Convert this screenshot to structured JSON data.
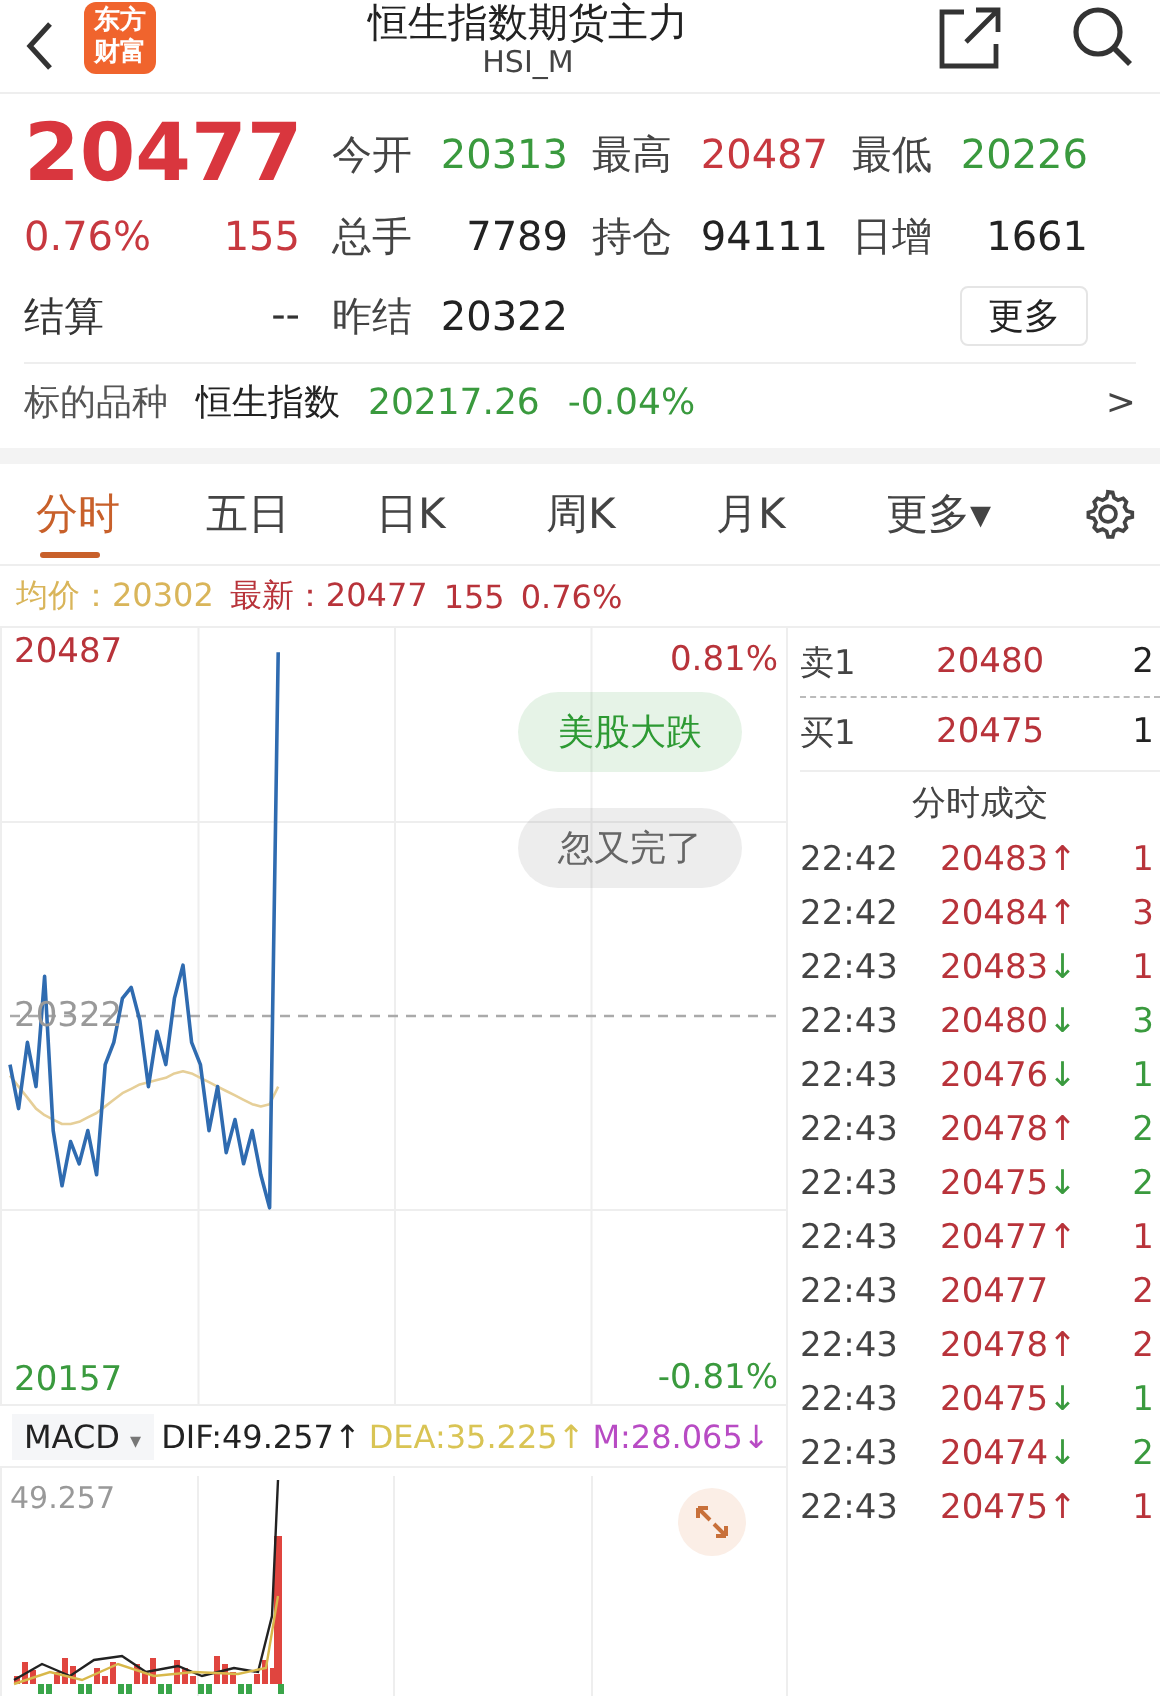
{
  "header": {
    "logo": "东方财富",
    "title": "恒生指数期货主力",
    "code": "HSI_M"
  },
  "quote": {
    "price": "20477",
    "change_pct": "0.76%",
    "change": "155",
    "settle_label": "结算",
    "settle": "--",
    "more": "更多",
    "stats": [
      {
        "label": "今开",
        "value": "20313",
        "color": "#3a9a3e"
      },
      {
        "label": "最高",
        "value": "20487",
        "color": "#c7383f"
      },
      {
        "label": "最低",
        "value": "20226",
        "color": "#3a9a3e"
      },
      {
        "label": "总手",
        "value": "7789",
        "color": "#222222"
      },
      {
        "label": "持仓",
        "value": "94111",
        "color": "#222222"
      },
      {
        "label": "日增",
        "value": "1661",
        "color": "#222222"
      },
      {
        "label": "昨结",
        "value": "20322",
        "color": "#222222"
      }
    ]
  },
  "underlying": {
    "label": "标的品种",
    "name": "恒生指数",
    "price": "20217.26",
    "change": "-0.04%",
    "chevron": ">"
  },
  "tabs": [
    {
      "label": "分时",
      "selected": true
    },
    {
      "label": "五日",
      "selected": false
    },
    {
      "label": "日K",
      "selected": false
    },
    {
      "label": "周K",
      "selected": false
    },
    {
      "label": "月K",
      "selected": false
    },
    {
      "label": "更多▾",
      "selected": false
    }
  ],
  "info": {
    "avg_label": "均价：",
    "avg": "20302",
    "latest_label": "最新：",
    "latest": "20477",
    "change": "155",
    "pct": "0.76%"
  },
  "chart": {
    "high_pct": "0.81%",
    "low_pct": "-0.81%",
    "tags": [
      {
        "text": "美股大跌",
        "color": "#2d9a33"
      },
      {
        "text": "忽又完了",
        "color": "#666666"
      }
    ],
    "chart_data": {
      "type": "line",
      "ylim": [
        20146,
        20498
      ],
      "yticks": [
        20157,
        20322,
        20487
      ],
      "categories": [
        null,
        null,
        null,
        null,
        null,
        null,
        null,
        null,
        null,
        null,
        null,
        null,
        null,
        null,
        null,
        null,
        null,
        null,
        null,
        null,
        null,
        null,
        null,
        null,
        null,
        null,
        null,
        null,
        null,
        null,
        null,
        null,
        null,
        null,
        null,
        null,
        null,
        null,
        null,
        null,
        null,
        null,
        null,
        null,
        null,
        null,
        null,
        null,
        null,
        null,
        null,
        null,
        null,
        null,
        null,
        null,
        null,
        null,
        null,
        null,
        null,
        null,
        null,
        null,
        null,
        null,
        null,
        null,
        null,
        null,
        null,
        null,
        null,
        null,
        null,
        null,
        null,
        null,
        null,
        null,
        null,
        null,
        null,
        null,
        null,
        null,
        null,
        null,
        null,
        null
      ],
      "series": [
        {
          "color": "#2f6bb0",
          "values": [
            20300,
            20280,
            20310,
            20290,
            20340,
            20270,
            20245,
            20265,
            20255,
            20270,
            20250,
            20300,
            20310,
            20330,
            20335,
            20320,
            20290,
            20315,
            20300,
            20330,
            20345,
            20310,
            20300,
            20270,
            20290,
            20260,
            20275,
            20255,
            20270,
            20250,
            20235,
            20487,
            null,
            null,
            null,
            null,
            null,
            null,
            null,
            null,
            null,
            null,
            null,
            null,
            null,
            null,
            null,
            null,
            null,
            null,
            null,
            null,
            null,
            null,
            null,
            null,
            null,
            null,
            null,
            null,
            null,
            null,
            null,
            null,
            null,
            null,
            null,
            null,
            null,
            null,
            null,
            null,
            null,
            null,
            null,
            null,
            null,
            null,
            null,
            null,
            null,
            null,
            null,
            null,
            null,
            null,
            null,
            null,
            null,
            null
          ]
        },
        {
          "color": "#e6cf98",
          "values": [
            20295,
            20290,
            20285,
            20280,
            20277,
            20275,
            20273,
            20273,
            20274,
            20276,
            20278,
            20281,
            20284,
            20287,
            20289,
            20291,
            20292,
            20293,
            20294,
            20296,
            20297,
            20296,
            20294,
            20292,
            20290,
            20288,
            20286,
            20284,
            20282,
            20281,
            20282,
            20290,
            null,
            null,
            null,
            null,
            null,
            null,
            null,
            null,
            null,
            null,
            null,
            null,
            null,
            null,
            null,
            null,
            null,
            null,
            null,
            null,
            null,
            null,
            null,
            null,
            null,
            null,
            null,
            null,
            null,
            null,
            null,
            null,
            null,
            null,
            null,
            null,
            null,
            null,
            null,
            null,
            null,
            null,
            null,
            null,
            null,
            null,
            null,
            null,
            null,
            null,
            null,
            null,
            null,
            null,
            null,
            null,
            null,
            null
          ]
        },
        {
          "color": "#aaaaaa",
          "line_style": "dashed",
          "values": [
            20322,
            20322,
            20322,
            20322,
            20322,
            20322,
            20322,
            20322,
            20322,
            20322,
            20322,
            20322,
            20322,
            20322,
            20322,
            20322,
            20322,
            20322,
            20322,
            20322,
            20322,
            20322,
            20322,
            20322,
            20322,
            20322,
            20322,
            20322,
            20322,
            20322,
            20322,
            20322,
            20322,
            20322,
            20322,
            20322,
            20322,
            20322,
            20322,
            20322,
            20322,
            20322,
            20322,
            20322,
            20322,
            20322,
            20322,
            20322,
            20322,
            20322,
            20322,
            20322,
            20322,
            20322,
            20322,
            20322,
            20322,
            20322,
            20322,
            20322,
            20322,
            20322,
            20322,
            20322,
            20322,
            20322,
            20322,
            20322,
            20322,
            20322,
            20322,
            20322,
            20322,
            20322,
            20322,
            20322,
            20322,
            20322,
            20322,
            20322,
            20322,
            20322,
            20322,
            20322,
            20322,
            20322,
            20322,
            20322,
            20322,
            20322
          ]
        }
      ]
    }
  },
  "orderbook": [
    {
      "label": "卖1",
      "price": "20480",
      "qty": "2"
    },
    {
      "label": "买1",
      "price": "20475",
      "qty": "1"
    }
  ],
  "trades": {
    "title": "分时成交",
    "rows": [
      {
        "time": "22:42",
        "price": "20483",
        "arrow": "↑",
        "up": true,
        "qty": "1",
        "buy": true
      },
      {
        "time": "22:42",
        "price": "20484",
        "arrow": "↑",
        "up": true,
        "qty": "3",
        "buy": true
      },
      {
        "time": "22:43",
        "price": "20483",
        "arrow": "↓",
        "up": false,
        "qty": "1",
        "buy": true
      },
      {
        "time": "22:43",
        "price": "20480",
        "arrow": "↓",
        "up": false,
        "qty": "3",
        "buy": false
      },
      {
        "time": "22:43",
        "price": "20476",
        "arrow": "↓",
        "up": false,
        "qty": "1",
        "buy": false
      },
      {
        "time": "22:43",
        "price": "20478",
        "arrow": "↑",
        "up": true,
        "qty": "2",
        "buy": false
      },
      {
        "time": "22:43",
        "price": "20475",
        "arrow": "↓",
        "up": false,
        "qty": "2",
        "buy": false
      },
      {
        "time": "22:43",
        "price": "20477",
        "arrow": "↑",
        "up": true,
        "qty": "1",
        "buy": true
      },
      {
        "time": "22:43",
        "price": "20477",
        "qty": "2",
        "buy": true
      },
      {
        "time": "22:43",
        "price": "20478",
        "arrow": "↑",
        "up": true,
        "qty": "2",
        "buy": true
      },
      {
        "time": "22:43",
        "price": "20475",
        "arrow": "↓",
        "up": false,
        "qty": "1",
        "buy": false
      },
      {
        "time": "22:43",
        "price": "20474",
        "arrow": "↓",
        "up": false,
        "qty": "2",
        "buy": false
      },
      {
        "time": "22:43",
        "price": "20475",
        "arrow": "↑",
        "up": true,
        "qty": "1",
        "buy": true
      }
    ]
  },
  "macd": {
    "selector": "MACD",
    "caret": "▾",
    "dif": "DIF:49.257↑",
    "dea": "DEA:35.225↑",
    "m": "M:28.065↓",
    "axis": "49.257"
  }
}
